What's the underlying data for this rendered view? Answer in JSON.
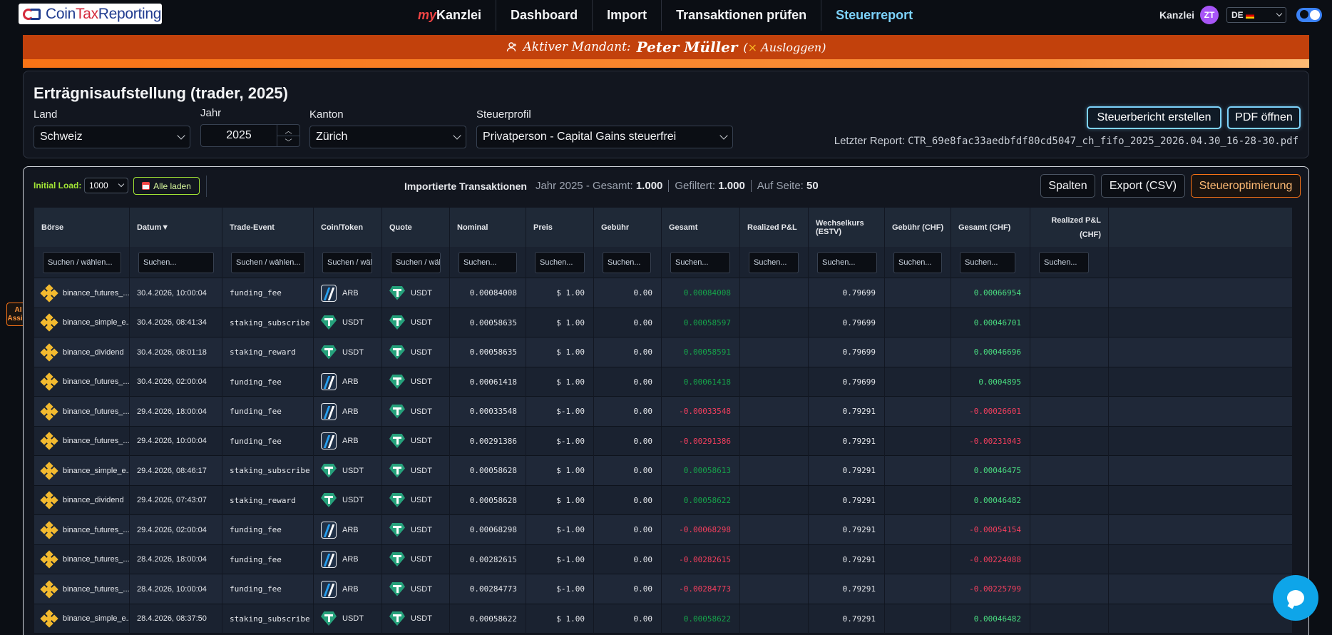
{
  "nav": {
    "logo_prefix": "Coin",
    "logo_tax": "Tax",
    "logo_suffix": "Reporting",
    "my_prefix": "my",
    "my_suffix": "Kanzlei",
    "links": [
      "Dashboard",
      "Import",
      "Transaktionen prüfen",
      "Steuerreport"
    ],
    "kanzlei_label": "Kanzlei",
    "avatar_initials": "ZT",
    "language": "DE"
  },
  "banner": {
    "prefix": "Aktiver Mandant:",
    "client_name": "Peter Müller",
    "logout_x": "×",
    "logout_label": "Ausloggen"
  },
  "report": {
    "title": "Erträgnisaufstellung (trader, 2025)",
    "land_label": "Land",
    "land_value": "Schweiz",
    "jahr_label": "Jahr",
    "jahr_value": "2025",
    "kanton_label": "Kanton",
    "kanton_value": "Zürich",
    "profil_label": "Steuerprofil",
    "profil_value": "Privatperson - Capital Gains steuerfrei",
    "create_button": "Steuerbericht erstellen",
    "pdf_button": "PDF öffnen",
    "last_report_label": "Letzter Report:",
    "last_report_file": "CTR_69e8fac33aedbfdf80cd5047_ch_fifo_2025_2026.04.30_16-28-30.pdf"
  },
  "toolbar": {
    "initial_load_label": "Initial Load:",
    "initial_load_value": "1000",
    "load_all": "Alle laden",
    "imported_label": "Importierte Transaktionen",
    "year_total_label": "Jahr 2025 - Gesamt:",
    "total_value": "1.000",
    "filtered_label": "Gefiltert:",
    "filtered_value": "1.000",
    "page_label": "Auf Seite:",
    "page_value": "50",
    "columns_button": "Spalten",
    "export_button": "Export (CSV)",
    "optimize_button": "Steueroptimierung"
  },
  "table": {
    "headers": [
      "Börse",
      "Datum▼",
      "Trade-Event",
      "Coin/Token",
      "Quote",
      "Nominal",
      "Preis",
      "Gebühr",
      "Gesamt",
      "Realized P&L",
      "Wechselkurs (ESTV)",
      "Gebühr (CHF)",
      "Gesamt (CHF)",
      "Realized P&L (CHF)"
    ],
    "filters": [
      "Suchen / wählen...",
      "Suchen...",
      "Suchen / wählen...",
      "Suchen / wäh",
      "Suchen / wäh",
      "Suchen...",
      "Suchen...",
      "Suchen...",
      "Suchen...",
      "Suchen...",
      "Suchen...",
      "Suchen...",
      "Suchen...",
      "Suchen..."
    ],
    "rows": [
      {
        "exchange": "binance_futures_...",
        "date": "30.4.2026, 10:00:04",
        "event": "funding_fee",
        "coin": "ARB",
        "quote": "USDT",
        "nominal": "0.00084008",
        "price": "$ 1.00",
        "fee": "0.00",
        "total": "0.00084008",
        "rate": "0.79699",
        "total_chf": "0.00066954"
      },
      {
        "exchange": "binance_simple_e...",
        "date": "30.4.2026, 08:41:34",
        "event": "staking_subscribe",
        "coin": "USDT",
        "quote": "USDT",
        "nominal": "0.00058635",
        "price": "$ 1.00",
        "fee": "0.00",
        "total": "0.00058597",
        "rate": "0.79699",
        "total_chf": "0.00046701"
      },
      {
        "exchange": "binance_dividend",
        "date": "30.4.2026, 08:01:18",
        "event": "staking_reward",
        "coin": "USDT",
        "quote": "USDT",
        "nominal": "0.00058635",
        "price": "$ 1.00",
        "fee": "0.00",
        "total": "0.00058591",
        "rate": "0.79699",
        "total_chf": "0.00046696"
      },
      {
        "exchange": "binance_futures_...",
        "date": "30.4.2026, 02:00:04",
        "event": "funding_fee",
        "coin": "ARB",
        "quote": "USDT",
        "nominal": "0.00061418",
        "price": "$ 1.00",
        "fee": "0.00",
        "total": "0.00061418",
        "rate": "0.79699",
        "total_chf": "0.0004895"
      },
      {
        "exchange": "binance_futures_...",
        "date": "29.4.2026, 18:00:04",
        "event": "funding_fee",
        "coin": "ARB",
        "quote": "USDT",
        "nominal": "0.00033548",
        "price": "$-1.00",
        "fee": "0.00",
        "total": "-0.00033548",
        "rate": "0.79291",
        "total_chf": "-0.00026601"
      },
      {
        "exchange": "binance_futures_...",
        "date": "29.4.2026, 10:00:04",
        "event": "funding_fee",
        "coin": "ARB",
        "quote": "USDT",
        "nominal": "0.00291386",
        "price": "$-1.00",
        "fee": "0.00",
        "total": "-0.00291386",
        "rate": "0.79291",
        "total_chf": "-0.00231043"
      },
      {
        "exchange": "binance_simple_e...",
        "date": "29.4.2026, 08:46:17",
        "event": "staking_subscribe",
        "coin": "USDT",
        "quote": "USDT",
        "nominal": "0.00058628",
        "price": "$ 1.00",
        "fee": "0.00",
        "total": "0.00058613",
        "rate": "0.79291",
        "total_chf": "0.00046475"
      },
      {
        "exchange": "binance_dividend",
        "date": "29.4.2026, 07:43:07",
        "event": "staking_reward",
        "coin": "USDT",
        "quote": "USDT",
        "nominal": "0.00058628",
        "price": "$ 1.00",
        "fee": "0.00",
        "total": "0.00058622",
        "rate": "0.79291",
        "total_chf": "0.00046482"
      },
      {
        "exchange": "binance_futures_...",
        "date": "29.4.2026, 02:00:04",
        "event": "funding_fee",
        "coin": "ARB",
        "quote": "USDT",
        "nominal": "0.00068298",
        "price": "$-1.00",
        "fee": "0.00",
        "total": "-0.00068298",
        "rate": "0.79291",
        "total_chf": "-0.00054154"
      },
      {
        "exchange": "binance_futures_...",
        "date": "28.4.2026, 18:00:04",
        "event": "funding_fee",
        "coin": "ARB",
        "quote": "USDT",
        "nominal": "0.00282615",
        "price": "$-1.00",
        "fee": "0.00",
        "total": "-0.00282615",
        "rate": "0.79291",
        "total_chf": "-0.00224088"
      },
      {
        "exchange": "binance_futures_...",
        "date": "28.4.2026, 10:00:04",
        "event": "funding_fee",
        "coin": "ARB",
        "quote": "USDT",
        "nominal": "0.00284773",
        "price": "$-1.00",
        "fee": "0.00",
        "total": "-0.00284773",
        "rate": "0.79291",
        "total_chf": "-0.00225799"
      },
      {
        "exchange": "binance_simple_e...",
        "date": "28.4.2026, 08:37:50",
        "event": "staking_subscribe",
        "coin": "USDT",
        "quote": "USDT",
        "nominal": "0.00058622",
        "price": "$ 1.00",
        "fee": "0.00",
        "total": "0.00058622",
        "rate": "0.79291",
        "total_chf": "0.00046482"
      }
    ]
  },
  "ai_assist": {
    "line1": "AI",
    "line2": "Assist"
  },
  "colors": {
    "accent_orange": "#f97316",
    "accent_blue": "#7dd3fc",
    "positive": "#4ade80",
    "negative": "#f43f5e"
  },
  "icons": {
    "exchange": "binance-icon",
    "arb": "arbitrum-icon",
    "usdt": "tether-icon",
    "chat": "chat-bubble-icon",
    "user": "user-icon"
  }
}
